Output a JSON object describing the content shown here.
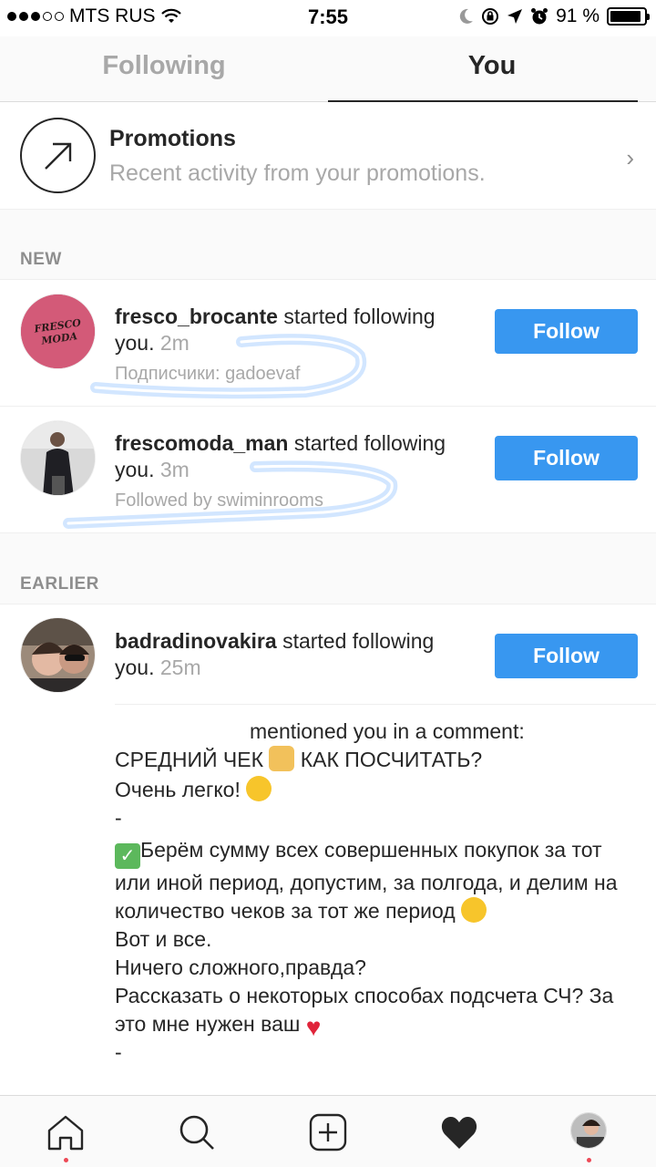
{
  "status_bar": {
    "carrier": "MTS RUS",
    "time": "7:55",
    "battery_percent": "91 %",
    "battery_level": 0.91
  },
  "tabs": [
    {
      "label": "Following",
      "active": false
    },
    {
      "label": "You",
      "active": true
    }
  ],
  "promotions": {
    "title": "Promotions",
    "subtitle": "Recent activity from your promotions.",
    "chevron": "›"
  },
  "sections": {
    "new": "NEW",
    "earlier": "EARLIER"
  },
  "notifications": [
    {
      "username": "fresco_brocante",
      "action": " started following you.",
      "time": "2m",
      "sub": "Подписчики: gadoevaf",
      "button": "Follow",
      "avatar_text": "FRESCO MODA"
    },
    {
      "username": "frescomoda_man",
      "action": " started following you.",
      "time": "3m",
      "sub": "Followed by swiminrooms",
      "button": "Follow"
    },
    {
      "username": "badradinovakira",
      "action": " started following you.",
      "time": "25m",
      "button": "Follow"
    }
  ],
  "comment": {
    "line1": "mentioned you in a comment:",
    "line2": "СРЕДНИЙ ЧЕК",
    "line2b": "КАК ПОСЧИТАТЬ?",
    "line3": "Очень легко!",
    "line4": "-",
    "line5": "Берём сумму всех совершенных покупок за тот или иной период, допустим, за полгода, и делим на количество чеков за тот же период",
    "line6": "Вот и все.",
    "line7": "Ничего сложного,правда?",
    "line8": "Рассказать о некоторых способах подсчета СЧ? За это мне нужен ваш",
    "line9": "-"
  },
  "tabbar": {
    "icons": [
      "home-icon",
      "search-icon",
      "add-post-icon",
      "heart-icon",
      "profile-avatar"
    ]
  },
  "colors": {
    "follow_button": "#3897f0",
    "notification_dot": "#ed4956",
    "secondary_text": "#a8a8a8"
  }
}
